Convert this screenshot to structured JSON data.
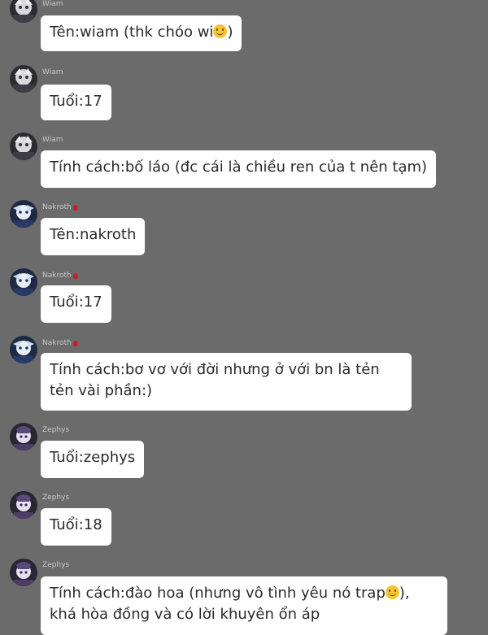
{
  "messages": [
    {
      "sender": "Wiam",
      "avatar": "wiam-avatar",
      "text": "Tên:wiam (thk chóo wi",
      "emoji": "slightly-smiling-face",
      "after": ")"
    },
    {
      "sender": "Wiam",
      "avatar": "wiam-avatar",
      "text": "Tuổi:17"
    },
    {
      "sender": "Wiam",
      "avatar": "wiam-avatar",
      "text": "Tính cách:bố láo (đc cái là chiều ren của t nên tạm)"
    },
    {
      "sender": "Nakroth",
      "avatar": "nakroth-avatar",
      "badge": "rose-icon",
      "text": "Tên:nakroth"
    },
    {
      "sender": "Nakroth",
      "avatar": "nakroth-avatar",
      "badge": "rose-icon",
      "text": "Tuổi:17"
    },
    {
      "sender": "Nakroth",
      "avatar": "nakroth-avatar",
      "badge": "rose-icon",
      "text": "Tính cách:bơ vơ với đời nhưng ở với bn là tẻn tẻn vài phần:)"
    },
    {
      "sender": "Zephys",
      "avatar": "zephys-avatar",
      "text": "Tuổi:zephys"
    },
    {
      "sender": "Zephys",
      "avatar": "zephys-avatar",
      "text": "Tuổi:18"
    },
    {
      "sender": "Zephys",
      "avatar": "zephys-avatar",
      "text": "Tính cách:đào hoa (nhưng vô tình yêu nó trap",
      "emoji": "slightly-smiling-face",
      "after": "), khá hòa đồng và có lời khuyên ổn áp"
    }
  ],
  "colors": {
    "background": "#6b6b6b",
    "bubble": "#ffffff",
    "bubble_text": "#2a2a2a",
    "sender_name": "#c9c9c9",
    "rose": "#c8202a"
  }
}
